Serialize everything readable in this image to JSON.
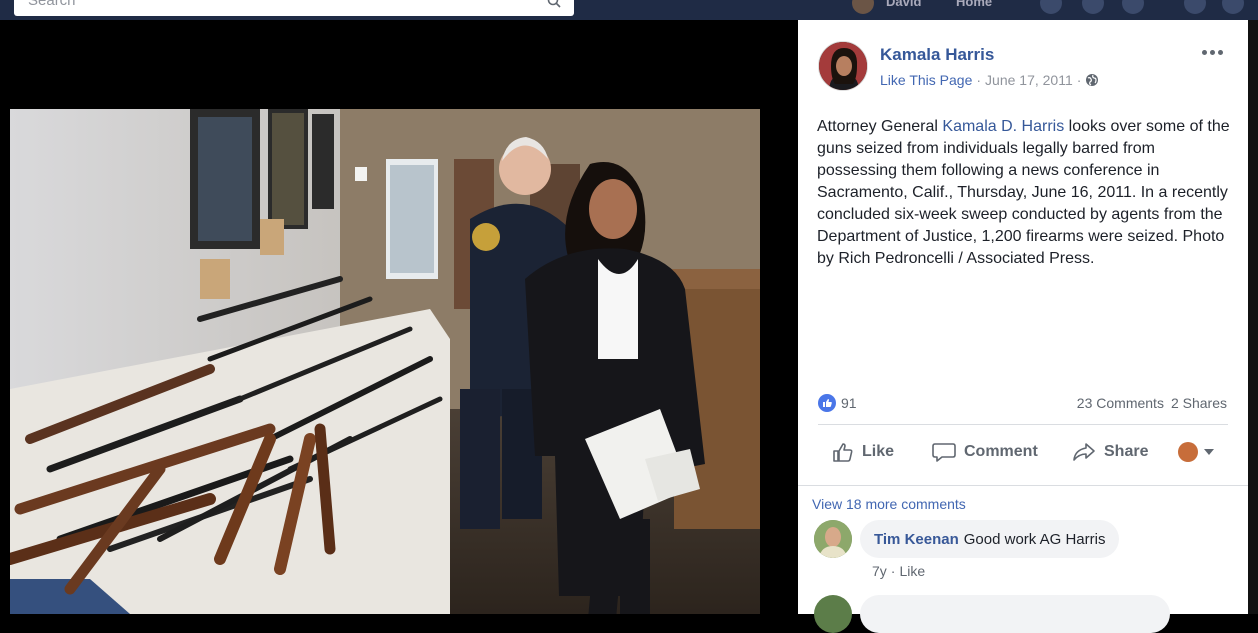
{
  "topbar": {
    "search_placeholder": "Search",
    "user_name": "David",
    "home_label": "Home"
  },
  "post": {
    "page_name": "Kamala Harris",
    "like_page": "Like This Page",
    "separator": "·",
    "date": "June 17, 2011",
    "audience_icon": "globe-icon",
    "caption_before": "Attorney General ",
    "caption_mention": "Kamala D. Harris",
    "caption_after": " looks over some of the guns seized from individuals legally barred from possessing them following a news conference in Sacramento, Calif., Thursday, June 16, 2011. In a recently concluded six-week sweep conducted by agents from the Department of Justice, 1,200 firearms were seized. Photo by Rich Pedroncelli / Associated Press.",
    "reaction_count": "91",
    "comments_count": "23 Comments",
    "shares_count": "2 Shares"
  },
  "actions": {
    "like": "Like",
    "comment": "Comment",
    "share": "Share"
  },
  "comments": {
    "view_more": "View 18 more comments",
    "items": [
      {
        "author": "Tim Keenan",
        "text": "Good work AG Harris",
        "time": "7y",
        "like": "Like"
      }
    ]
  },
  "colors": {
    "link": "#365899",
    "topbar": "#1f2b45",
    "like_blue": "#4a76e8"
  }
}
